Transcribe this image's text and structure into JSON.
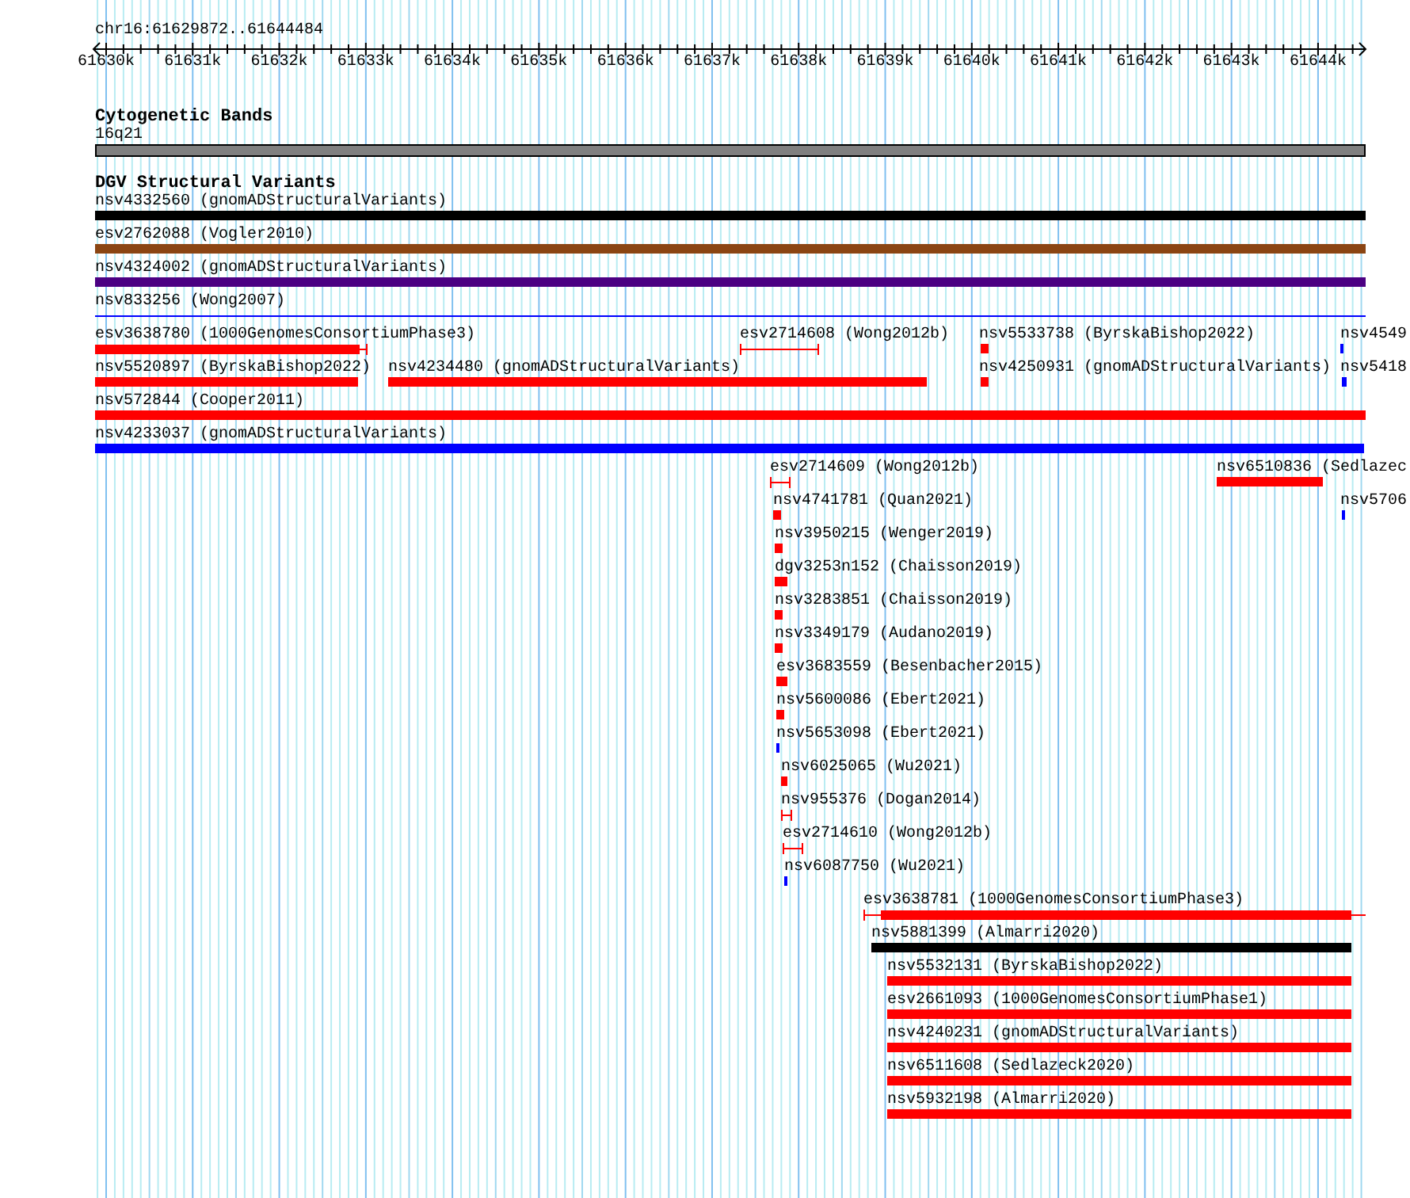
{
  "ruler": {
    "location": "chr16:61629872..61644484",
    "ticks": [
      "61630k",
      "61631k",
      "61632k",
      "61633k",
      "61634k",
      "61635k",
      "61636k",
      "61637k",
      "61638k",
      "61639k",
      "61640k",
      "61641k",
      "61642k",
      "61643k",
      "61644k"
    ]
  },
  "tracks": [
    {
      "title": "Cytogenetic Bands",
      "features": [
        {
          "label": "16q21",
          "kind": "band",
          "color": "#808080"
        }
      ]
    },
    {
      "title": "DGV Structural Variants",
      "features": [
        {
          "label": "nsv4332560 (gnomADStructuralVariants)",
          "kind": "bar",
          "color": "#000000"
        },
        {
          "label": "esv2762088 (Vogler2010)",
          "kind": "bar",
          "color": "#8b4513"
        },
        {
          "label": "nsv4324002 (gnomADStructuralVariants)",
          "kind": "bar",
          "color": "#4b0082"
        },
        {
          "label": "nsv833256 (Wong2007)",
          "kind": "line",
          "color": "#0000ff"
        },
        {
          "label": "esv3638780 (1000GenomesConsortiumPhase3)",
          "kind": "capped",
          "color": "#ff0000"
        },
        {
          "label": "esv2714608 (Wong2012b)",
          "kind": "span",
          "color": "#ff0000"
        },
        {
          "label": "nsv5533738 (ByrskaBishop2022)",
          "kind": "bar",
          "color": "#ff0000"
        },
        {
          "label": "nsv4549",
          "kind": "bar",
          "color": "#0000ff"
        },
        {
          "label": "nsv5520897 (ByrskaBishop2022)",
          "kind": "bar",
          "color": "#ff0000"
        },
        {
          "label": "nsv4234480 (gnomADStructuralVariants)",
          "kind": "bar",
          "color": "#ff0000"
        },
        {
          "label": "nsv4250931 (gnomADStructuralVariants)",
          "kind": "bar",
          "color": "#ff0000"
        },
        {
          "label": "nsv5418",
          "kind": "bar",
          "color": "#0000ff"
        },
        {
          "label": "nsv572844 (Cooper2011)",
          "kind": "bar",
          "color": "#ff0000"
        },
        {
          "label": "nsv4233037 (gnomADStructuralVariants)",
          "kind": "bar",
          "color": "#0000ff"
        },
        {
          "label": "esv2714609 (Wong2012b)",
          "kind": "span",
          "color": "#ff0000"
        },
        {
          "label": "nsv6510836 (Sedlazec",
          "kind": "bar",
          "color": "#ff0000"
        },
        {
          "label": "nsv4741781 (Quan2021)",
          "kind": "bar",
          "color": "#ff0000"
        },
        {
          "label": "nsv5706",
          "kind": "bar",
          "color": "#0000ff"
        },
        {
          "label": "nsv3950215 (Wenger2019)",
          "kind": "bar",
          "color": "#ff0000"
        },
        {
          "label": "dgv3253n152 (Chaisson2019)",
          "kind": "bar",
          "color": "#ff0000"
        },
        {
          "label": "nsv3283851 (Chaisson2019)",
          "kind": "bar",
          "color": "#ff0000"
        },
        {
          "label": "nsv3349179 (Audano2019)",
          "kind": "bar",
          "color": "#ff0000"
        },
        {
          "label": "esv3683559 (Besenbacher2015)",
          "kind": "bar",
          "color": "#ff0000"
        },
        {
          "label": "nsv5600086 (Ebert2021)",
          "kind": "bar",
          "color": "#ff0000"
        },
        {
          "label": "nsv5653098 (Ebert2021)",
          "kind": "bar",
          "color": "#0000ff"
        },
        {
          "label": "nsv6025065 (Wu2021)",
          "kind": "bar",
          "color": "#ff0000"
        },
        {
          "label": "nsv955376 (Dogan2014)",
          "kind": "span",
          "color": "#ff0000"
        },
        {
          "label": "esv2714610 (Wong2012b)",
          "kind": "span",
          "color": "#ff0000"
        },
        {
          "label": "nsv6087750 (Wu2021)",
          "kind": "bar",
          "color": "#0000ff"
        },
        {
          "label": "esv3638781 (1000GenomesConsortiumPhase3)",
          "kind": "tailed",
          "color": "#ff0000"
        },
        {
          "label": "nsv5881399 (Almarri2020)",
          "kind": "bar",
          "color": "#000000"
        },
        {
          "label": "nsv5532131 (ByrskaBishop2022)",
          "kind": "bar",
          "color": "#ff0000"
        },
        {
          "label": "esv2661093 (1000GenomesConsortiumPhase1)",
          "kind": "bar",
          "color": "#ff0000"
        },
        {
          "label": "nsv4240231 (gnomADStructuralVariants)",
          "kind": "bar",
          "color": "#ff0000"
        },
        {
          "label": "nsv6511608 (Sedlazeck2020)",
          "kind": "bar",
          "color": "#ff0000"
        },
        {
          "label": "nsv5932198 (Almarri2020)",
          "kind": "bar",
          "color": "#ff0000"
        }
      ]
    }
  ]
}
